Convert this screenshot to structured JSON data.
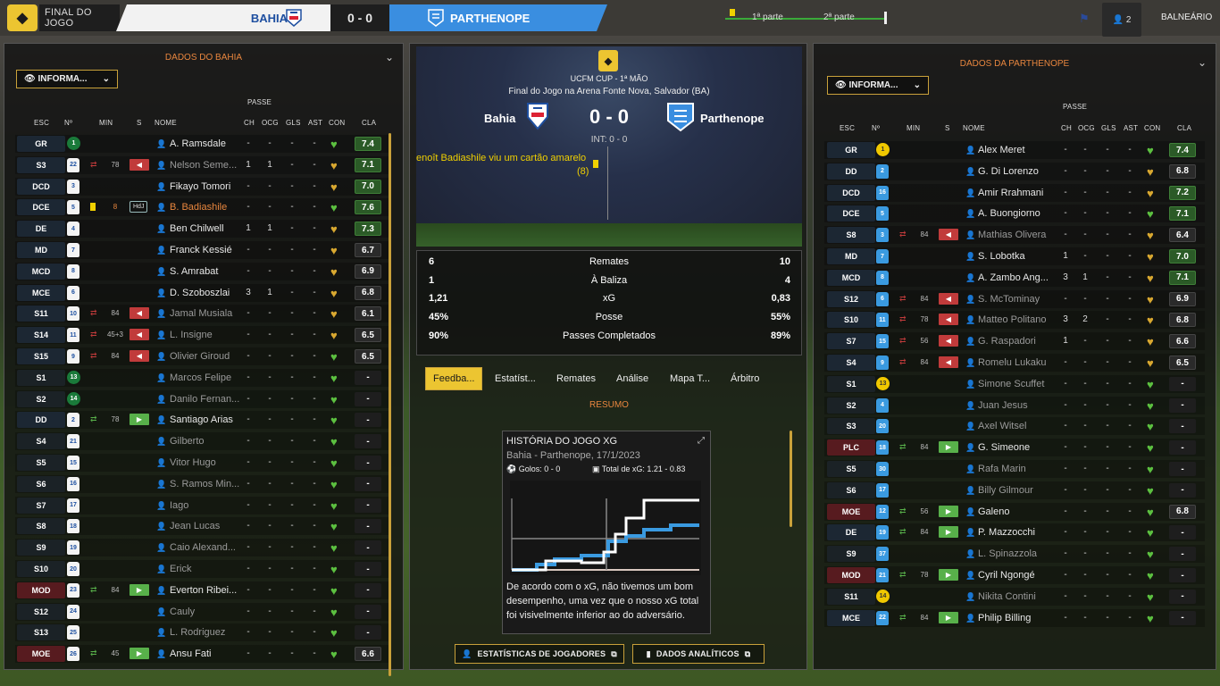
{
  "topbar": {
    "final_label": "FINAL DO JOGO",
    "home_team": "BAHIA",
    "score": "0 - 0",
    "away_team": "PARTHENOPE",
    "timeline_first": "1ª parte",
    "timeline_second": "2ª parte",
    "people_count": "2",
    "balneario": "BALNEÁRIO"
  },
  "left": {
    "title": "DADOS DO BAHIA",
    "info_label": "INFORMA...",
    "passe": "PASSE",
    "cols": {
      "esc": "ESC",
      "num": "Nº",
      "min": "MIN",
      "s": "S",
      "nome": "NOME",
      "ch": "CH",
      "ocg": "OCG",
      "gls": "GLS",
      "ast": "AST",
      "con": "CON",
      "cla": "CLA"
    },
    "players": [
      {
        "pos": "GR",
        "num": "1",
        "name": "A. Ramsdale",
        "min": "",
        "s": "",
        "ch": "-",
        "ocg": "-",
        "gls": "-",
        "ast": "-",
        "cla": "7.4",
        "kind": "start"
      },
      {
        "pos": "S3",
        "num": "22",
        "name": "Nelson Seme...",
        "min": "78",
        "s": "out",
        "ch": "1",
        "ocg": "1",
        "gls": "-",
        "ast": "-",
        "cla": "7.1",
        "kind": "startoff"
      },
      {
        "pos": "DCD",
        "num": "3",
        "name": "Fikayo Tomori",
        "min": "",
        "s": "",
        "ch": "-",
        "ocg": "-",
        "gls": "-",
        "ast": "-",
        "cla": "7.0",
        "kind": "start"
      },
      {
        "pos": "DCE",
        "num": "5",
        "name": "B. Badiashile",
        "min": "",
        "s": "card",
        "ch": "-",
        "ocg": "-",
        "gls": "-",
        "ast": "-",
        "cla": "7.6",
        "kind": "booked",
        "extra": "HdJ"
      },
      {
        "pos": "DE",
        "num": "4",
        "name": "Ben Chilwell",
        "min": "",
        "s": "",
        "ch": "1",
        "ocg": "1",
        "gls": "-",
        "ast": "-",
        "cla": "7.3",
        "kind": "start"
      },
      {
        "pos": "MD",
        "num": "7",
        "name": "Franck Kessié",
        "min": "",
        "s": "",
        "ch": "-",
        "ocg": "-",
        "gls": "-",
        "ast": "-",
        "cla": "6.7",
        "kind": "start"
      },
      {
        "pos": "MCD",
        "num": "8",
        "name": "S. Amrabat",
        "min": "",
        "s": "",
        "ch": "-",
        "ocg": "-",
        "gls": "-",
        "ast": "-",
        "cla": "6.9",
        "kind": "start"
      },
      {
        "pos": "MCE",
        "num": "6",
        "name": "D. Szoboszlai",
        "min": "",
        "s": "",
        "ch": "3",
        "ocg": "1",
        "gls": "-",
        "ast": "-",
        "cla": "6.8",
        "kind": "start"
      },
      {
        "pos": "S11",
        "num": "10",
        "name": "Jamal Musiala",
        "min": "84",
        "s": "out",
        "ch": "-",
        "ocg": "-",
        "gls": "-",
        "ast": "-",
        "cla": "6.1",
        "kind": "startoff"
      },
      {
        "pos": "S14",
        "num": "11",
        "name": "L. Insigne",
        "min": "45+3",
        "s": "out",
        "ch": "-",
        "ocg": "-",
        "gls": "-",
        "ast": "-",
        "cla": "6.5",
        "kind": "startoff"
      },
      {
        "pos": "S15",
        "num": "9",
        "name": "Olivier Giroud",
        "min": "84",
        "s": "out",
        "ch": "-",
        "ocg": "-",
        "gls": "-",
        "ast": "-",
        "cla": "6.5",
        "kind": "startoff"
      },
      {
        "pos": "S1",
        "num": "13",
        "name": "Marcos Felipe",
        "min": "",
        "s": "",
        "ch": "-",
        "ocg": "-",
        "gls": "-",
        "ast": "-",
        "cla": "-",
        "kind": "subgk"
      },
      {
        "pos": "S2",
        "num": "14",
        "name": "Danilo Fernan...",
        "min": "",
        "s": "",
        "ch": "-",
        "ocg": "-",
        "gls": "-",
        "ast": "-",
        "cla": "-",
        "kind": "subgk"
      },
      {
        "pos": "DD",
        "num": "2",
        "name": "Santiago Arias",
        "min": "78",
        "s": "in",
        "ch": "-",
        "ocg": "-",
        "gls": "-",
        "ast": "-",
        "cla": "-",
        "kind": "subin"
      },
      {
        "pos": "S4",
        "num": "21",
        "name": "Gilberto",
        "min": "",
        "s": "",
        "ch": "-",
        "ocg": "-",
        "gls": "-",
        "ast": "-",
        "cla": "-",
        "kind": "sub"
      },
      {
        "pos": "S5",
        "num": "15",
        "name": "Vitor Hugo",
        "min": "",
        "s": "",
        "ch": "-",
        "ocg": "-",
        "gls": "-",
        "ast": "-",
        "cla": "-",
        "kind": "sub"
      },
      {
        "pos": "S6",
        "num": "16",
        "name": "S. Ramos Min...",
        "min": "",
        "s": "",
        "ch": "-",
        "ocg": "-",
        "gls": "-",
        "ast": "-",
        "cla": "-",
        "kind": "sub"
      },
      {
        "pos": "S7",
        "num": "17",
        "name": "Iago",
        "min": "",
        "s": "",
        "ch": "-",
        "ocg": "-",
        "gls": "-",
        "ast": "-",
        "cla": "-",
        "kind": "sub"
      },
      {
        "pos": "S8",
        "num": "18",
        "name": "Jean Lucas",
        "min": "",
        "s": "",
        "ch": "-",
        "ocg": "-",
        "gls": "-",
        "ast": "-",
        "cla": "-",
        "kind": "sub"
      },
      {
        "pos": "S9",
        "num": "19",
        "name": "Caio Alexand...",
        "min": "",
        "s": "",
        "ch": "-",
        "ocg": "-",
        "gls": "-",
        "ast": "-",
        "cla": "-",
        "kind": "sub"
      },
      {
        "pos": "S10",
        "num": "20",
        "name": "Erick",
        "min": "",
        "s": "",
        "ch": "-",
        "ocg": "-",
        "gls": "-",
        "ast": "-",
        "cla": "-",
        "kind": "sub"
      },
      {
        "pos": "MOD",
        "num": "23",
        "name": "Everton Ribei...",
        "min": "84",
        "s": "in",
        "ch": "-",
        "ocg": "-",
        "gls": "-",
        "ast": "-",
        "cla": "-",
        "kind": "subinred"
      },
      {
        "pos": "S12",
        "num": "24",
        "name": "Cauly",
        "min": "",
        "s": "",
        "ch": "-",
        "ocg": "-",
        "gls": "-",
        "ast": "-",
        "cla": "-",
        "kind": "sub"
      },
      {
        "pos": "S13",
        "num": "25",
        "name": "L. Rodriguez",
        "min": "",
        "s": "",
        "ch": "-",
        "ocg": "-",
        "gls": "-",
        "ast": "-",
        "cla": "-",
        "kind": "sub"
      },
      {
        "pos": "MOE",
        "num": "26",
        "name": "Ansu Fati",
        "min": "45",
        "s": "in",
        "ch": "-",
        "ocg": "-",
        "gls": "-",
        "ast": "-",
        "cla": "6.6",
        "kind": "subinred"
      }
    ]
  },
  "right": {
    "title": "DADOS DA PARTHENOPE",
    "info_label": "INFORMA...",
    "passe": "PASSE",
    "cols": {
      "esc": "ESC",
      "num": "Nº",
      "min": "MIN",
      "s": "S",
      "nome": "NOME",
      "ch": "CH",
      "ocg": "OCG",
      "gls": "GLS",
      "ast": "AST",
      "con": "CON",
      "cla": "CLA"
    },
    "players": [
      {
        "pos": "GR",
        "num": "1",
        "name": "Alex Meret",
        "min": "",
        "s": "",
        "ch": "-",
        "ocg": "-",
        "gls": "-",
        "ast": "-",
        "cla": "7.4",
        "kind": "startgk"
      },
      {
        "pos": "DD",
        "num": "2",
        "name": "G. Di Lorenzo",
        "min": "",
        "s": "",
        "ch": "-",
        "ocg": "-",
        "gls": "-",
        "ast": "-",
        "cla": "6.8",
        "kind": "start"
      },
      {
        "pos": "DCD",
        "num": "16",
        "name": "Amir Rrahmani",
        "min": "",
        "s": "",
        "ch": "-",
        "ocg": "-",
        "gls": "-",
        "ast": "-",
        "cla": "7.2",
        "kind": "start"
      },
      {
        "pos": "DCE",
        "num": "5",
        "name": "A. Buongiorno",
        "min": "",
        "s": "",
        "ch": "-",
        "ocg": "-",
        "gls": "-",
        "ast": "-",
        "cla": "7.1",
        "kind": "start"
      },
      {
        "pos": "S8",
        "num": "3",
        "name": "Mathias Olivera",
        "min": "84",
        "s": "out",
        "ch": "-",
        "ocg": "-",
        "gls": "-",
        "ast": "-",
        "cla": "6.4",
        "kind": "startoff"
      },
      {
        "pos": "MD",
        "num": "7",
        "name": "S. Lobotka",
        "min": "",
        "s": "",
        "ch": "1",
        "ocg": "-",
        "gls": "-",
        "ast": "-",
        "cla": "7.0",
        "kind": "start"
      },
      {
        "pos": "MCD",
        "num": "8",
        "name": "A. Zambo Ang...",
        "min": "",
        "s": "",
        "ch": "3",
        "ocg": "1",
        "gls": "-",
        "ast": "-",
        "cla": "7.1",
        "kind": "start"
      },
      {
        "pos": "S12",
        "num": "6",
        "name": "S. McTominay",
        "min": "84",
        "s": "out",
        "ch": "-",
        "ocg": "-",
        "gls": "-",
        "ast": "-",
        "cla": "6.9",
        "kind": "startoff"
      },
      {
        "pos": "S10",
        "num": "11",
        "name": "Matteo Politano",
        "min": "78",
        "s": "out",
        "ch": "3",
        "ocg": "2",
        "gls": "-",
        "ast": "-",
        "cla": "6.8",
        "kind": "startoff"
      },
      {
        "pos": "S7",
        "num": "15",
        "name": "G. Raspadori",
        "min": "56",
        "s": "out",
        "ch": "1",
        "ocg": "-",
        "gls": "-",
        "ast": "-",
        "cla": "6.6",
        "kind": "startoff"
      },
      {
        "pos": "S4",
        "num": "9",
        "name": "Romelu Lukaku",
        "min": "84",
        "s": "out",
        "ch": "-",
        "ocg": "-",
        "gls": "-",
        "ast": "-",
        "cla": "6.5",
        "kind": "startoff"
      },
      {
        "pos": "S1",
        "num": "13",
        "name": "Simone Scuffet",
        "min": "",
        "s": "",
        "ch": "-",
        "ocg": "-",
        "gls": "-",
        "ast": "-",
        "cla": "-",
        "kind": "subgk"
      },
      {
        "pos": "S2",
        "num": "4",
        "name": "Juan Jesus",
        "min": "",
        "s": "",
        "ch": "-",
        "ocg": "-",
        "gls": "-",
        "ast": "-",
        "cla": "-",
        "kind": "sub"
      },
      {
        "pos": "S3",
        "num": "20",
        "name": "Axel Witsel",
        "min": "",
        "s": "",
        "ch": "-",
        "ocg": "-",
        "gls": "-",
        "ast": "-",
        "cla": "-",
        "kind": "sub"
      },
      {
        "pos": "PLC",
        "num": "18",
        "name": "G. Simeone",
        "min": "84",
        "s": "in",
        "ch": "-",
        "ocg": "-",
        "gls": "-",
        "ast": "-",
        "cla": "-",
        "kind": "subinred"
      },
      {
        "pos": "S5",
        "num": "30",
        "name": "Rafa Marin",
        "min": "",
        "s": "",
        "ch": "-",
        "ocg": "-",
        "gls": "-",
        "ast": "-",
        "cla": "-",
        "kind": "sub"
      },
      {
        "pos": "S6",
        "num": "17",
        "name": "Billy Gilmour",
        "min": "",
        "s": "",
        "ch": "-",
        "ocg": "-",
        "gls": "-",
        "ast": "-",
        "cla": "-",
        "kind": "sub"
      },
      {
        "pos": "MOE",
        "num": "12",
        "name": "Galeno",
        "min": "56",
        "s": "in",
        "ch": "-",
        "ocg": "-",
        "gls": "-",
        "ast": "-",
        "cla": "6.8",
        "kind": "subinred"
      },
      {
        "pos": "DE",
        "num": "19",
        "name": "P. Mazzocchi",
        "min": "84",
        "s": "in",
        "ch": "-",
        "ocg": "-",
        "gls": "-",
        "ast": "-",
        "cla": "-",
        "kind": "subin"
      },
      {
        "pos": "S9",
        "num": "37",
        "name": "L. Spinazzola",
        "min": "",
        "s": "",
        "ch": "-",
        "ocg": "-",
        "gls": "-",
        "ast": "-",
        "cla": "-",
        "kind": "sub"
      },
      {
        "pos": "MOD",
        "num": "21",
        "name": "Cyril Ngongé",
        "min": "78",
        "s": "in",
        "ch": "-",
        "ocg": "-",
        "gls": "-",
        "ast": "-",
        "cla": "-",
        "kind": "subinred"
      },
      {
        "pos": "S11",
        "num": "14",
        "name": "Nikita Contini",
        "min": "",
        "s": "",
        "ch": "-",
        "ocg": "-",
        "gls": "-",
        "ast": "-",
        "cla": "-",
        "kind": "subgk"
      },
      {
        "pos": "MCE",
        "num": "22",
        "name": "Philip Billing",
        "min": "84",
        "s": "in",
        "ch": "-",
        "ocg": "-",
        "gls": "-",
        "ast": "-",
        "cla": "-",
        "kind": "subin"
      }
    ]
  },
  "match": {
    "cup": "UCFM CUP - 1ª MÃO",
    "venue": "Final do Jogo na Arena Fonte Nova, Salvador (BA)",
    "home": "Bahia",
    "away": "Parthenope",
    "score": "0 - 0",
    "int": "INT: 0 - 0",
    "event": "enoît Badiashile viu um cartão amarelo",
    "event_min": "(8)"
  },
  "stats": [
    {
      "home": "6",
      "label": "Remates",
      "away": "10"
    },
    {
      "home": "1",
      "label": "À Baliza",
      "away": "4"
    },
    {
      "home": "1,21",
      "label": "xG",
      "away": "0,83"
    },
    {
      "home": "45%",
      "label": "Posse",
      "away": "55%"
    },
    {
      "home": "90%",
      "label": "Passes Completados",
      "away": "89%"
    }
  ],
  "tabs": [
    "Feedba...",
    "Estatíst...",
    "Remates",
    "Análise",
    "Mapa T...",
    "Árbitro"
  ],
  "resumo": "RESUMO",
  "xg_card": {
    "title": "HISTÓRIA DO JOGO XG",
    "subtitle": "Bahia - Parthenope, 17/1/2023",
    "goals": "Golos: 0 - 0",
    "total": "Total de xG: 1.21 - 0.83",
    "text": "De acordo com o xG, não tivemos um bom desempenho, uma vez que o nosso xG total foi visivelmente inferior ao do adversário."
  },
  "buttons": {
    "players": "ESTATÍSTICAS DE JOGADORES",
    "analytics": "DADOS ANALÍTICOS"
  },
  "colors": {
    "accent": "#ecc531",
    "home": "#1e4fa0",
    "away": "#3a8ee0",
    "rating_good": "#2b5a27",
    "out": "#c13b3b",
    "in": "#58b04a"
  }
}
